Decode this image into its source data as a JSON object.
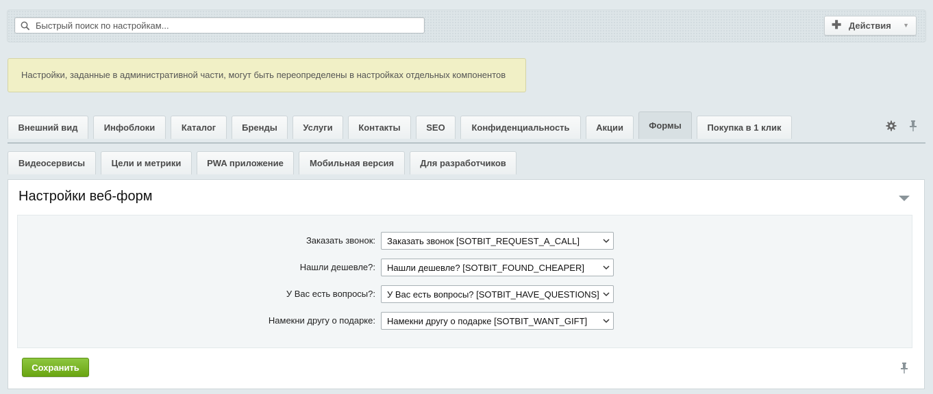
{
  "search": {
    "placeholder": "Быстрый поиск по настройкам..."
  },
  "actions": {
    "label": "Действия"
  },
  "notice": {
    "text": "Настройки, заданные в административной части, могут быть переопределены в настройках отдельных компонентов"
  },
  "tabs_row1": [
    {
      "label": "Внешний вид"
    },
    {
      "label": "Инфоблоки"
    },
    {
      "label": "Каталог"
    },
    {
      "label": "Бренды"
    },
    {
      "label": "Услуги"
    },
    {
      "label": "Контакты"
    },
    {
      "label": "SEO"
    },
    {
      "label": "Конфиденциальность"
    },
    {
      "label": "Акции"
    },
    {
      "label": "Формы",
      "active": true
    },
    {
      "label": "Покупка в 1 клик"
    }
  ],
  "tabs_row2": [
    {
      "label": "Видеосервисы"
    },
    {
      "label": "Цели и метрики"
    },
    {
      "label": "PWA приложение"
    },
    {
      "label": "Мобильная версия"
    },
    {
      "label": "Для разработчиков"
    }
  ],
  "panel": {
    "title": "Настройки веб-форм",
    "fields": [
      {
        "label": "Заказать звонок:",
        "value": "Заказать звонок [SOTBIT_REQUEST_A_CALL]"
      },
      {
        "label": "Нашли дешевле?:",
        "value": "Нашли дешевле? [SOTBIT_FOUND_CHEAPER]"
      },
      {
        "label": "У Вас есть вопросы?:",
        "value": "У Вас есть вопросы? [SOTBIT_HAVE_QUESTIONS]"
      },
      {
        "label": "Намекни другу о подарке:",
        "value": "Намекни другу о подарке [SOTBIT_WANT_GIFT]"
      }
    ]
  },
  "save": {
    "label": "Сохранить"
  },
  "colors": {
    "save_green": "#6aa512",
    "notice_bg": "#f1f0c6",
    "page_bg": "#e2e9ec"
  }
}
